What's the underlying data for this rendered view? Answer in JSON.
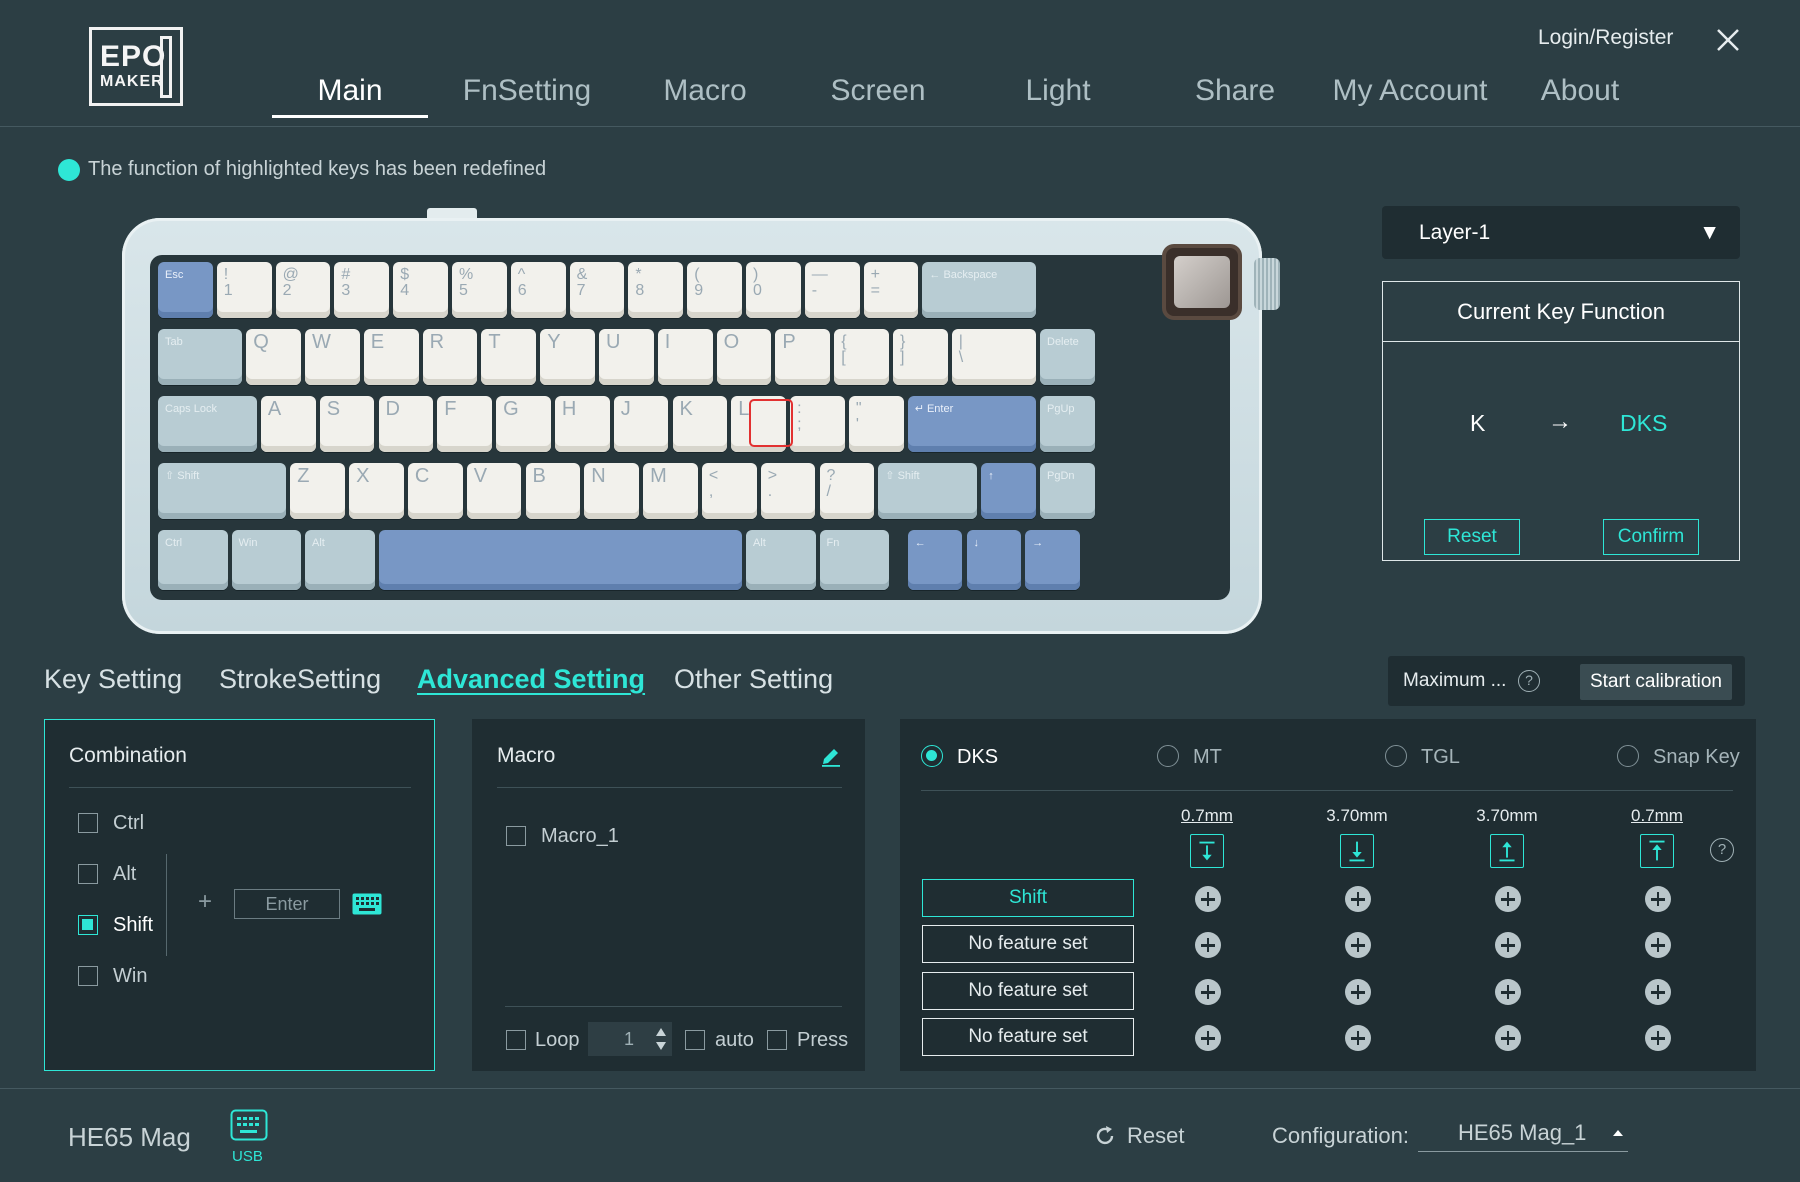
{
  "header": {
    "logo_line1": "EPO",
    "logo_line2": "MAKER",
    "login": "Login/Register",
    "nav": [
      {
        "label": "Main",
        "active": true
      },
      {
        "label": "FnSetting"
      },
      {
        "label": "Macro"
      },
      {
        "label": "Screen"
      },
      {
        "label": "Light"
      },
      {
        "label": "Share"
      },
      {
        "label": "My Account"
      },
      {
        "label": "About"
      }
    ]
  },
  "note": "The function of highlighted keys has been redefined",
  "keyboard": {
    "row1": [
      "Esc",
      "!\n1",
      "@\n2",
      "#\n3",
      "$\n4",
      "%\n5",
      "^\n6",
      "&\n7",
      "*\n8",
      "(\n9",
      ")\n0",
      "—\n-",
      "+\n=",
      "← Backspace"
    ],
    "row2": [
      "Tab",
      "Q",
      "W",
      "E",
      "R",
      "T",
      "Y",
      "U",
      "I",
      "O",
      "P",
      "{\n[",
      "}\n]",
      "|\n\\",
      "Delete"
    ],
    "row3": [
      "Caps Lock",
      "A",
      "S",
      "D",
      "F",
      "G",
      "H",
      "J",
      "K",
      "L",
      ":\n;",
      "\"\n'",
      "↵ Enter",
      "PgUp"
    ],
    "row4": [
      "⇧ Shift",
      "Z",
      "X",
      "C",
      "V",
      "B",
      "N",
      "M",
      "<\n,",
      ">\n.",
      "?\n/",
      "⇧ Shift",
      "↑",
      "PgDn"
    ],
    "row5": [
      "Ctrl",
      "Win",
      "Alt",
      "",
      "Alt",
      "Fn",
      "←",
      "↓",
      "→"
    ]
  },
  "layer": {
    "selected": "Layer-1",
    "caret": "▼"
  },
  "current_key": {
    "title": "Current Key Function",
    "from": "K",
    "arrow": "→",
    "to": "DKS",
    "reset": "Reset",
    "confirm": "Confirm"
  },
  "settings_tabs": [
    {
      "label": "Key Setting"
    },
    {
      "label": "StrokeSetting"
    },
    {
      "label": "Advanced Setting",
      "active": true
    },
    {
      "label": "Other Setting"
    }
  ],
  "calibration": {
    "max_label": "Maximum ...",
    "help": "?",
    "button": "Start calibration"
  },
  "combination": {
    "title": "Combination",
    "modifiers": [
      {
        "label": "Ctrl",
        "checked": false
      },
      {
        "label": "Alt",
        "checked": false
      },
      {
        "label": "Shift",
        "checked": true
      },
      {
        "label": "Win",
        "checked": false
      }
    ],
    "plus": "+",
    "key_placeholder": "Enter"
  },
  "macro": {
    "title": "Macro",
    "items": [
      {
        "label": "Macro_1",
        "checked": false
      }
    ],
    "loop_label": "Loop",
    "loop_count": "1",
    "auto_label": "auto",
    "press_label": "Press"
  },
  "advanced": {
    "modes": [
      {
        "label": "DKS",
        "selected": true
      },
      {
        "label": "MT"
      },
      {
        "label": "TGL"
      },
      {
        "label": "Snap Key"
      }
    ],
    "distances": [
      "0.7mm",
      "3.70mm",
      "3.70mm",
      "0.7mm"
    ],
    "help": "?",
    "features": [
      "Shift",
      "No feature set",
      "No feature set",
      "No feature set"
    ]
  },
  "footer": {
    "device": "HE65 Mag",
    "connection": "USB",
    "reset": "Reset",
    "config_label": "Configuration:",
    "config_value": "HE65 Mag_1"
  },
  "colors": {
    "accent": "#2ee6d6",
    "background": "#2c3e44",
    "panel": "#1f2d32",
    "highlight_border": "#e23131"
  }
}
